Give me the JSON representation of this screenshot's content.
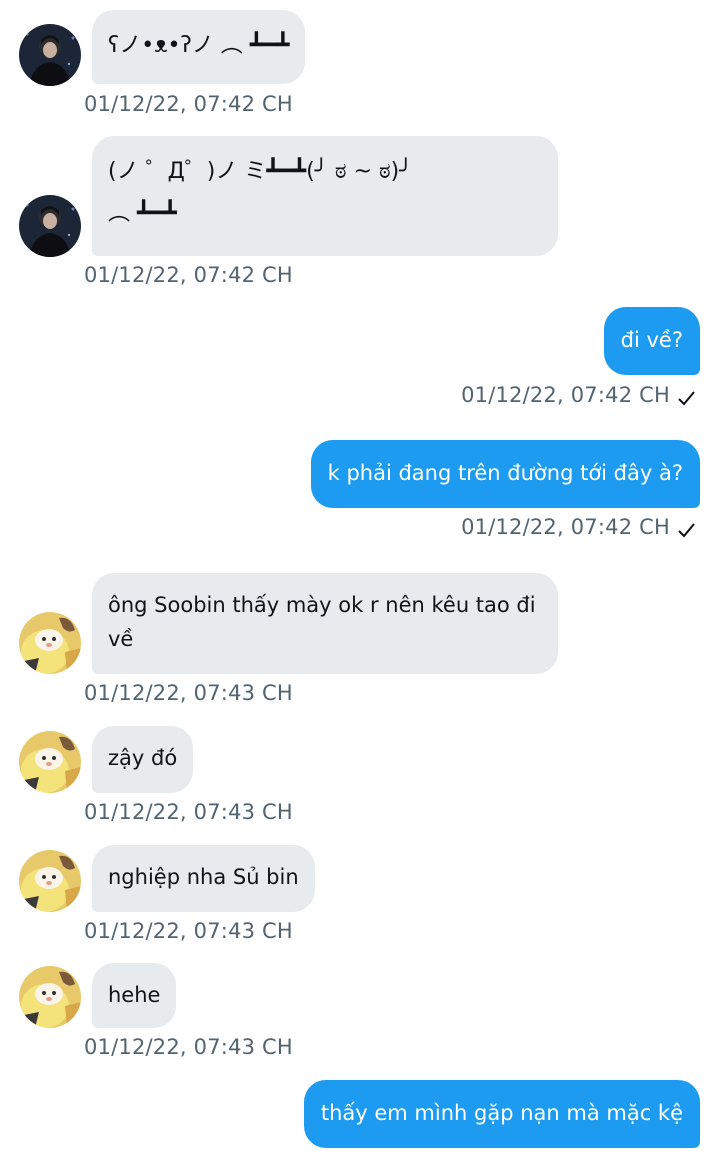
{
  "conversation": {
    "messages": [
      {
        "side": "in",
        "avatar": "avatar-dark-photo",
        "text": "ʕノ•ᴥ•ʔノ ︵ ┻━┻",
        "time": "01/12/22,  07:42 CH"
      },
      {
        "side": "in",
        "avatar": "avatar-dark-photo",
        "text": "(ノ ゜Д゜)ノ ミ┻━┻(╯ ಠ ~ ಠ)╯\n︵ ┻━┻",
        "time": "01/12/22,  07:42 CH"
      },
      {
        "side": "out",
        "text": "đi về?",
        "time": "01/12/22,  07:42 CH",
        "status": "sent-check"
      },
      {
        "side": "out",
        "text": "k phải đang trên đường tới đây à?",
        "time": "01/12/22,  07:42 CH",
        "status": "sent-check"
      },
      {
        "side": "in",
        "avatar": "avatar-yellow-plush",
        "text": "ông Soobin thấy mày ok r nên kêu tao đi\nvề",
        "time": "01/12/22,  07:43 CH"
      },
      {
        "side": "in",
        "avatar": "avatar-yellow-plush",
        "text": "zậy đó",
        "time": "01/12/22,  07:43 CH"
      },
      {
        "side": "in",
        "avatar": "avatar-yellow-plush",
        "text": "nghiệp nha Sủ bin",
        "time": "01/12/22,  07:43 CH"
      },
      {
        "side": "in",
        "avatar": "avatar-yellow-plush",
        "text": "hehe",
        "time": "01/12/22,  07:43 CH"
      },
      {
        "side": "out",
        "text": "thấy em mình gặp nạn mà mặc kệ",
        "time": ""
      }
    ]
  },
  "colors": {
    "incoming_bubble": "#e7ebee",
    "outgoing_bubble": "#1d9bf0",
    "timestamp": "#536471",
    "text": "#0f1419"
  }
}
